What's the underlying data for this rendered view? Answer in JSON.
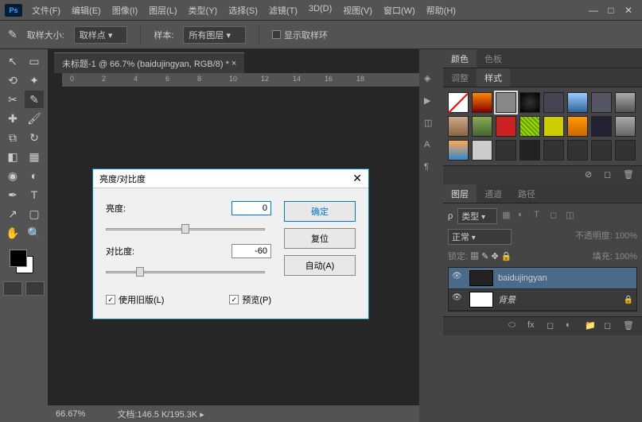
{
  "menu": {
    "items": [
      "文件(F)",
      "编辑(E)",
      "图像(I)",
      "图层(L)",
      "类型(Y)",
      "选择(S)",
      "滤镜(T)",
      "3D(D)",
      "视图(V)",
      "窗口(W)",
      "帮助(H)"
    ]
  },
  "optbar": {
    "sample_size_label": "取样大小:",
    "sample_size_value": "取样点",
    "sample_label": "样本:",
    "sample_value": "所有图层",
    "show_ring": "显示取样环"
  },
  "doc": {
    "tab": "未标题-1 @ 66.7% (baidujingyan, RGB/8) *",
    "zoom": "66.67%",
    "status_label": "文档:",
    "status_value": "146.5 K/195.3K"
  },
  "ruler": {
    "marks": [
      "0",
      "2",
      "4",
      "6",
      "8",
      "10",
      "12",
      "14",
      "16",
      "18"
    ]
  },
  "color_panel": {
    "tabs": [
      "颜色",
      "色板"
    ],
    "tabs2": [
      "调整",
      "样式"
    ]
  },
  "layers_panel": {
    "tabs": [
      "图层",
      "通道",
      "路径"
    ],
    "kind": "类型",
    "blend": "正常",
    "opacity_label": "不透明度:",
    "opacity": "100%",
    "lock_label": "锁定:",
    "fill_label": "填充:",
    "fill": "100%",
    "layers": [
      {
        "name": "baidujingyan"
      },
      {
        "name": "背景"
      }
    ]
  },
  "dialog": {
    "title": "亮度/对比度",
    "brightness_label": "亮度:",
    "brightness": "0",
    "contrast_label": "对比度:",
    "contrast": "-60",
    "use_legacy": "使用旧版(L)",
    "preview": "预览(P)",
    "ok": "确定",
    "reset": "复位",
    "auto": "自动(A)"
  }
}
